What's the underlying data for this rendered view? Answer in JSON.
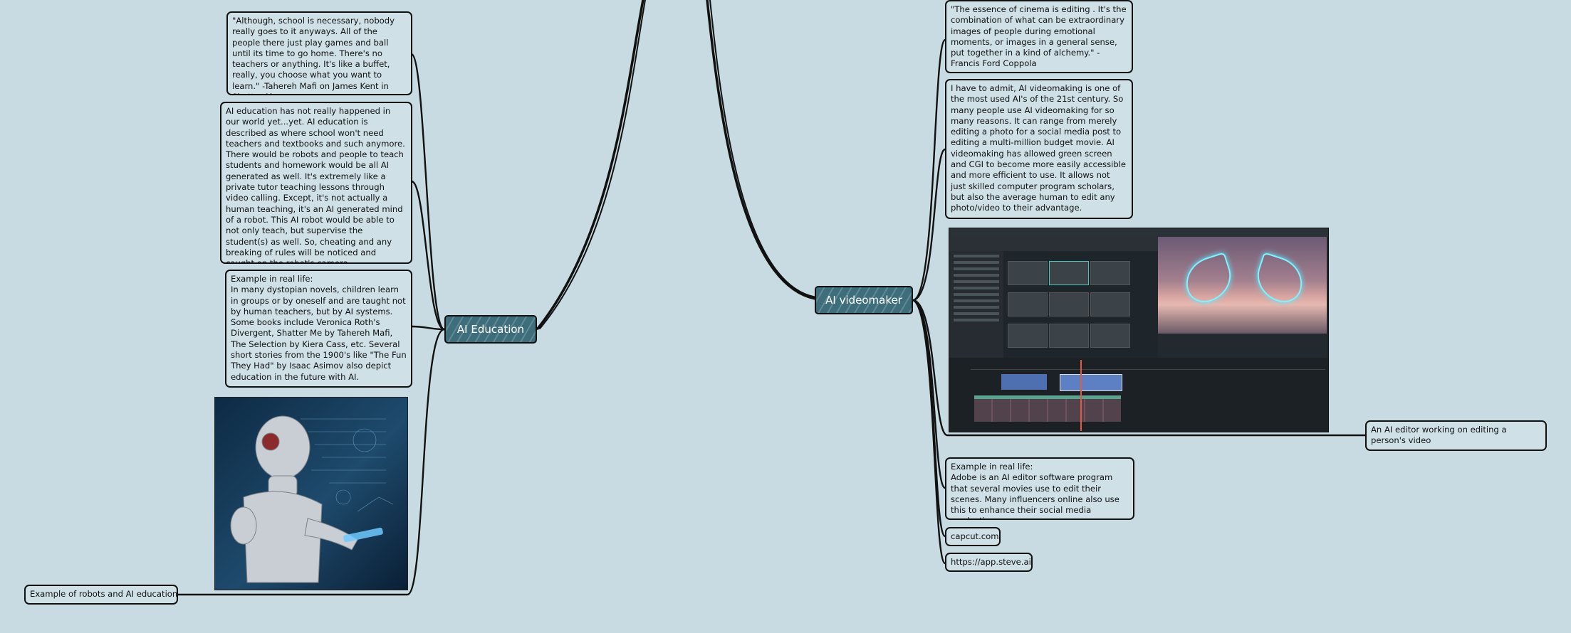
{
  "hubs": {
    "ai_education": "AI Education",
    "ai_videomaker": "AI videomaker"
  },
  "education_notes": {
    "quote": "\"Although, school is necessary, nobody really goes to it anyways. All of the people there just play games and ball until its time to go home. There's no teachers or anything. It's like a buffet, really, you choose what you want to learn.\" -Tahereh Mafi on James Kent in Shatter Me",
    "description": "AI education has not really happened in our world yet...yet. AI education is described as where school won't need teachers and textbooks and such anymore. There would be robots and people to teach students and homework would be all AI generated as well. It's extremely like a private tutor teaching lessons through video calling. Except, it's not actually a human teaching, it's an AI generated mind of a robot. This AI robot would be able to not only teach, but supervise the student(s) as well. So, cheating and any breaking of rules will be noticed and caught on the robot's camera.",
    "example": "Example in real life:\nIn many dystopian novels, children learn in groups or by oneself and are taught not by human teachers, but by AI systems. Some books include Veronica Roth's Divergent, Shatter Me by Tahereh Mafi, The Selection by Kiera Cass, etc. Several short stories from the 1900's like \"The Fun They Had\" by Isaac Asimov also depict education in the future with AI.",
    "image_caption": "Example of robots and AI education"
  },
  "video_notes": {
    "quote": "\"The essence of cinema is editing . It's the combination of what can be extraordinary images of people during emotional moments, or images in a general sense, put together in a kind of alchemy.\" -Francis Ford Coppola",
    "description": "I have to admit, AI videomaking is one of the most used AI's of the 21st century. So many people use AI videomaking for so many reasons. It can range from merely editing a photo for a social media post to editing a multi-million budget movie. AI videomaking has allowed green screen and CGI to become more easily accessible and more efficient to use. It allows not just skilled computer program scholars, but also the average human to edit any photo/video to their advantage.",
    "image_caption": "An AI editor working on editing a person's video",
    "example": "Example in real life:\nAdobe is an AI editor software program that several movies use to edit their scenes. Many influencers online also use this to enhance their social media productions.",
    "link_capcut": "capcut.com",
    "link_steve": "https://app.steve.ai"
  },
  "colors": {
    "background": "#c9dbe2",
    "hub_fill": "#3e6e7c",
    "ink": "#111111"
  }
}
